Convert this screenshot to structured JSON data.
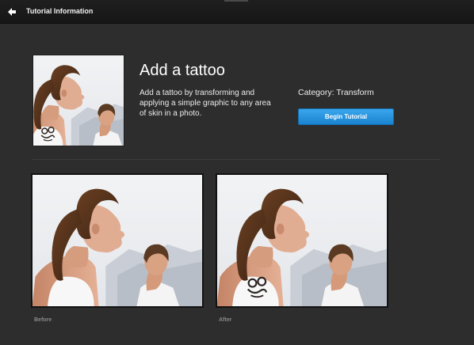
{
  "header": {
    "back_icon": "arrow-left-icon",
    "title": "Tutorial Information"
  },
  "tutorial": {
    "thumbnail": "tattoo-preview-photo",
    "title": "Add a tattoo",
    "description": "Add a tattoo by transforming and applying a simple graphic to any area of skin in a photo.",
    "category": "Category: Transform",
    "begin_button": "Begin Tutorial"
  },
  "comparison": {
    "before_label": "Before",
    "after_label": "After"
  },
  "colors": {
    "background": "#2d2d2d",
    "topbar": "#1a1a1a",
    "accent": "#2594de",
    "caption": "#8a8a8a"
  }
}
